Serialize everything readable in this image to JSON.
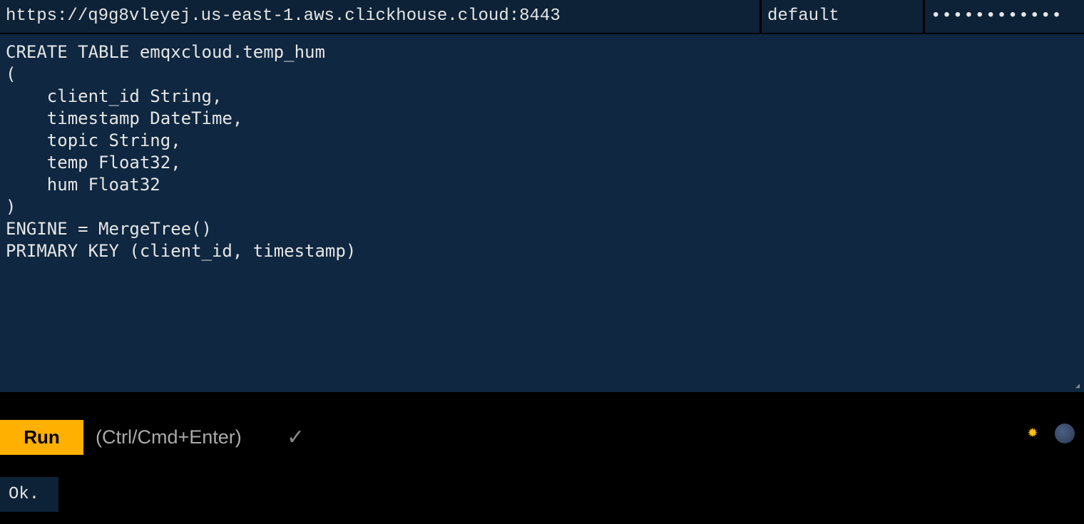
{
  "connection": {
    "url": "https://q9g8vleyej.us-east-1.aws.clickhouse.cloud:8443",
    "user": "default",
    "password_masked": "••••••••••••"
  },
  "query": "CREATE TABLE emqxcloud.temp_hum\n(\n    client_id String,\n    timestamp DateTime,\n    topic String,\n    temp Float32,\n    hum Float32\n)\nENGINE = MergeTree()\nPRIMARY KEY (client_id, timestamp)",
  "toolbar": {
    "run_label": "Run",
    "hint": "(Ctrl/Cmd+Enter)",
    "check_glyph": "✓",
    "theme_light_icon": "sun-icon",
    "theme_dark_icon": "moon-icon",
    "accent": "#ffb000"
  },
  "result": {
    "status": "Ok."
  }
}
